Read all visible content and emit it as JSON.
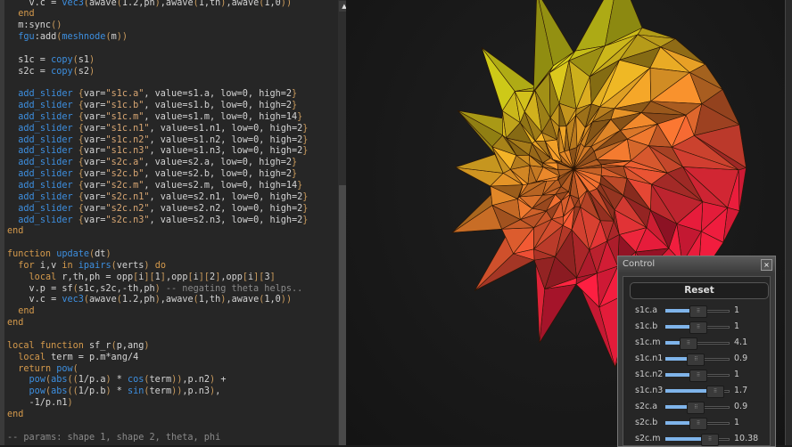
{
  "editor": {
    "lines": [
      "    v.c = vec3(awave(1.2,ph),awave(1,th),awave(1,0))",
      "  end",
      "  m:sync()",
      "  fgu:add(meshnode(m))",
      "",
      "  s1c = copy(s1)",
      "  s2c = copy(s2)",
      "",
      "  add_slider {var=\"s1c.a\", value=s1.a, low=0, high=2}",
      "  add_slider {var=\"s1c.b\", value=s1.b, low=0, high=2}",
      "  add_slider {var=\"s1c.m\", value=s1.m, low=0, high=14}",
      "  add_slider {var=\"s1c.n1\", value=s1.n1, low=0, high=2}",
      "  add_slider {var=\"s1c.n2\", value=s1.n2, low=0, high=2}",
      "  add_slider {var=\"s1c.n3\", value=s1.n3, low=0, high=2}",
      "  add_slider {var=\"s2c.a\", value=s2.a, low=0, high=2}",
      "  add_slider {var=\"s2c.b\", value=s2.b, low=0, high=2}",
      "  add_slider {var=\"s2c.m\", value=s2.m, low=0, high=14}",
      "  add_slider {var=\"s2c.n1\", value=s2.n1, low=0, high=2}",
      "  add_slider {var=\"s2c.n2\", value=s2.n2, low=0, high=2}",
      "  add_slider {var=\"s2c.n3\", value=s2.n3, low=0, high=2}",
      "end",
      "",
      "function update(dt)",
      "  for i,v in ipairs(verts) do",
      "    local r,th,ph = opp[i][1],opp[i][2],opp[i][3]",
      "    v.p = sf(s1c,s2c,-th,ph) -- negating theta helps..",
      "    v.c = vec3(awave(1.2,ph),awave(1,th),awave(1,0))",
      "  end",
      "end",
      "",
      "local function sf_r(p,ang)",
      "  local term = p.m*ang/4",
      "  return pow(",
      "    pow(abs((1/p.a) * cos(term)),p.n2) +",
      "    pow(abs((1/p.b) * sin(term)),p.n3),",
      "    -1/p.n1)",
      "end",
      "",
      "-- params: shape 1, shape 2, theta, phi"
    ],
    "scroll_up_icon": "triangle-up"
  },
  "control": {
    "title": "Control",
    "close_label": "×",
    "reset_label": "Reset",
    "sliders": [
      {
        "label": "s1c.a",
        "value": "1",
        "fraction": 0.5
      },
      {
        "label": "s1c.b",
        "value": "1",
        "fraction": 0.5
      },
      {
        "label": "s1c.m",
        "value": "4.1",
        "fraction": 0.293
      },
      {
        "label": "s1c.n1",
        "value": "0.9",
        "fraction": 0.45
      },
      {
        "label": "s1c.n2",
        "value": "1",
        "fraction": 0.5
      },
      {
        "label": "s1c.n3",
        "value": "1.7",
        "fraction": 0.85
      },
      {
        "label": "s2c.a",
        "value": "0.9",
        "fraction": 0.45
      },
      {
        "label": "s2c.b",
        "value": "1",
        "fraction": 0.5
      },
      {
        "label": "s2c.m",
        "value": "10.38",
        "fraction": 0.741
      }
    ]
  },
  "colors": {
    "keyword": "#d59a4c",
    "builtin": "#3d8fe0",
    "slider_fill": "#7fb4ea",
    "mesh_top": "#e8e040",
    "mesh_bottom": "#f02040"
  }
}
